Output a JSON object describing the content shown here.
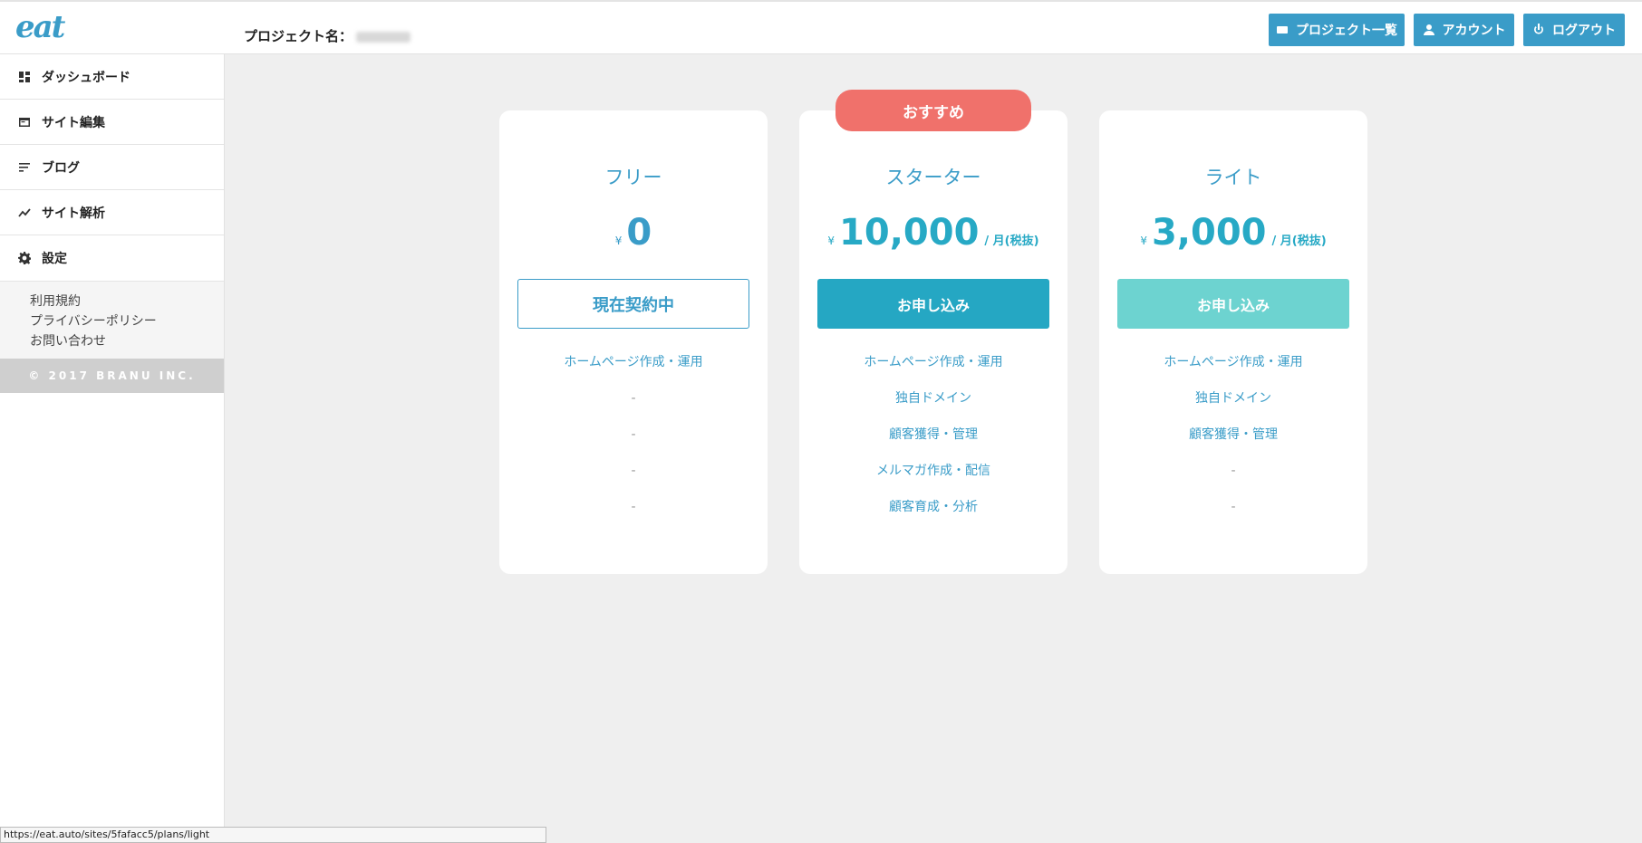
{
  "header": {
    "logo": "eat",
    "project_label": "プロジェクト名：",
    "buttons": {
      "projects": "プロジェクト一覧",
      "account": "アカウント",
      "logout": "ログアウト"
    }
  },
  "sidebar": {
    "items": [
      {
        "label": "ダッシュボード",
        "icon": "dashboard-icon"
      },
      {
        "label": "サイト編集",
        "icon": "site-edit-icon"
      },
      {
        "label": "ブログ",
        "icon": "blog-icon"
      },
      {
        "label": "サイト解析",
        "icon": "analytics-icon"
      },
      {
        "label": "設定",
        "icon": "gear-icon"
      }
    ],
    "links": [
      "利用規約",
      "プライバシーポリシー",
      "お問い合わせ"
    ],
    "copyright": "© 2017 BRANU INC."
  },
  "plans": {
    "recommend_label": "おすすめ",
    "cards": [
      {
        "name": "フリー",
        "yen": "¥",
        "amount": "0",
        "unit": "",
        "cta": "現在契約中",
        "features": [
          "ホームページ作成・運用",
          "-",
          "-",
          "-",
          "-"
        ]
      },
      {
        "name": "スターター",
        "yen": "¥",
        "amount": "10,000",
        "unit": "/ 月(税抜)",
        "cta": "お申し込み",
        "features": [
          "ホームページ作成・運用",
          "独自ドメイン",
          "顧客獲得・管理",
          "メルマガ作成・配信",
          "顧客育成・分析"
        ]
      },
      {
        "name": "ライト",
        "yen": "¥",
        "amount": "3,000",
        "unit": "/ 月(税抜)",
        "cta": "お申し込み",
        "features": [
          "ホームページ作成・運用",
          "独自ドメイン",
          "顧客獲得・管理",
          "-",
          "-"
        ]
      }
    ]
  },
  "statusbar": {
    "url": "https://eat.auto/sites/5fafacc5/plans/light"
  },
  "colors": {
    "accent": "#3a9cc8",
    "primary_button": "#25a7c3",
    "light_button": "#6dd3d0",
    "recommend": "#f0716b"
  }
}
